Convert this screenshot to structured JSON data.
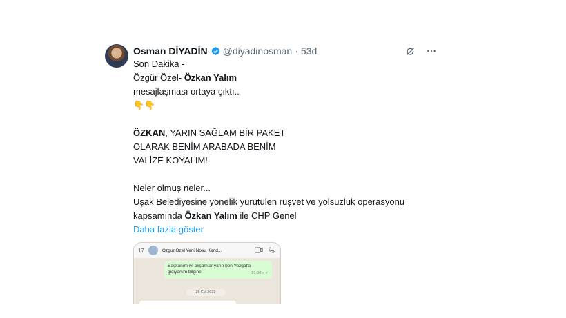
{
  "author": {
    "name": "Osman DİYADİN",
    "handle": "@diyadinosman",
    "separator": "·",
    "time": "53d"
  },
  "tweet": {
    "line1": "Son Dakika -",
    "line2_a": "Özgür Özel- ",
    "line2_b": "Özkan Yalım",
    "line3": "mesajlaşması ortaya çıktı..",
    "emojis": "👇👇",
    "quote_bold": "ÖZKAN",
    "quote_rest": ", YARIN SAĞLAM BİR PAKET",
    "quote_line2": "OLARAK BENİM ARABADA BENİM",
    "quote_line3": "VALİZE KOYALIM!",
    "para_line1": "Neler olmuş neler...",
    "para_line2": "Uşak Belediyesine yönelik yürütülen rüşvet ve yolsuzluk operasyonu",
    "para_line3_a": "kapsamında ",
    "para_line3_b": "Özkan Yalım",
    "para_line3_c": " ile CHP Genel",
    "show_more": "Daha fazla göster"
  },
  "media": {
    "back": "17",
    "contact": "Ozgur Ozel Yeni Nosu Kend...",
    "message": "Başkanım iyi akşamlar yarın ben Yozgat'a gidiyorum bilgine",
    "message_time": "21:00 ✓✓",
    "date": "26 Eyl 2023"
  },
  "icons": {
    "verified": "verified-badge-icon",
    "grok": "grok-icon",
    "more": "more-icon"
  },
  "colors": {
    "link": "#1d9bf0",
    "muted": "#536471",
    "verified": "#1d9bf0"
  }
}
